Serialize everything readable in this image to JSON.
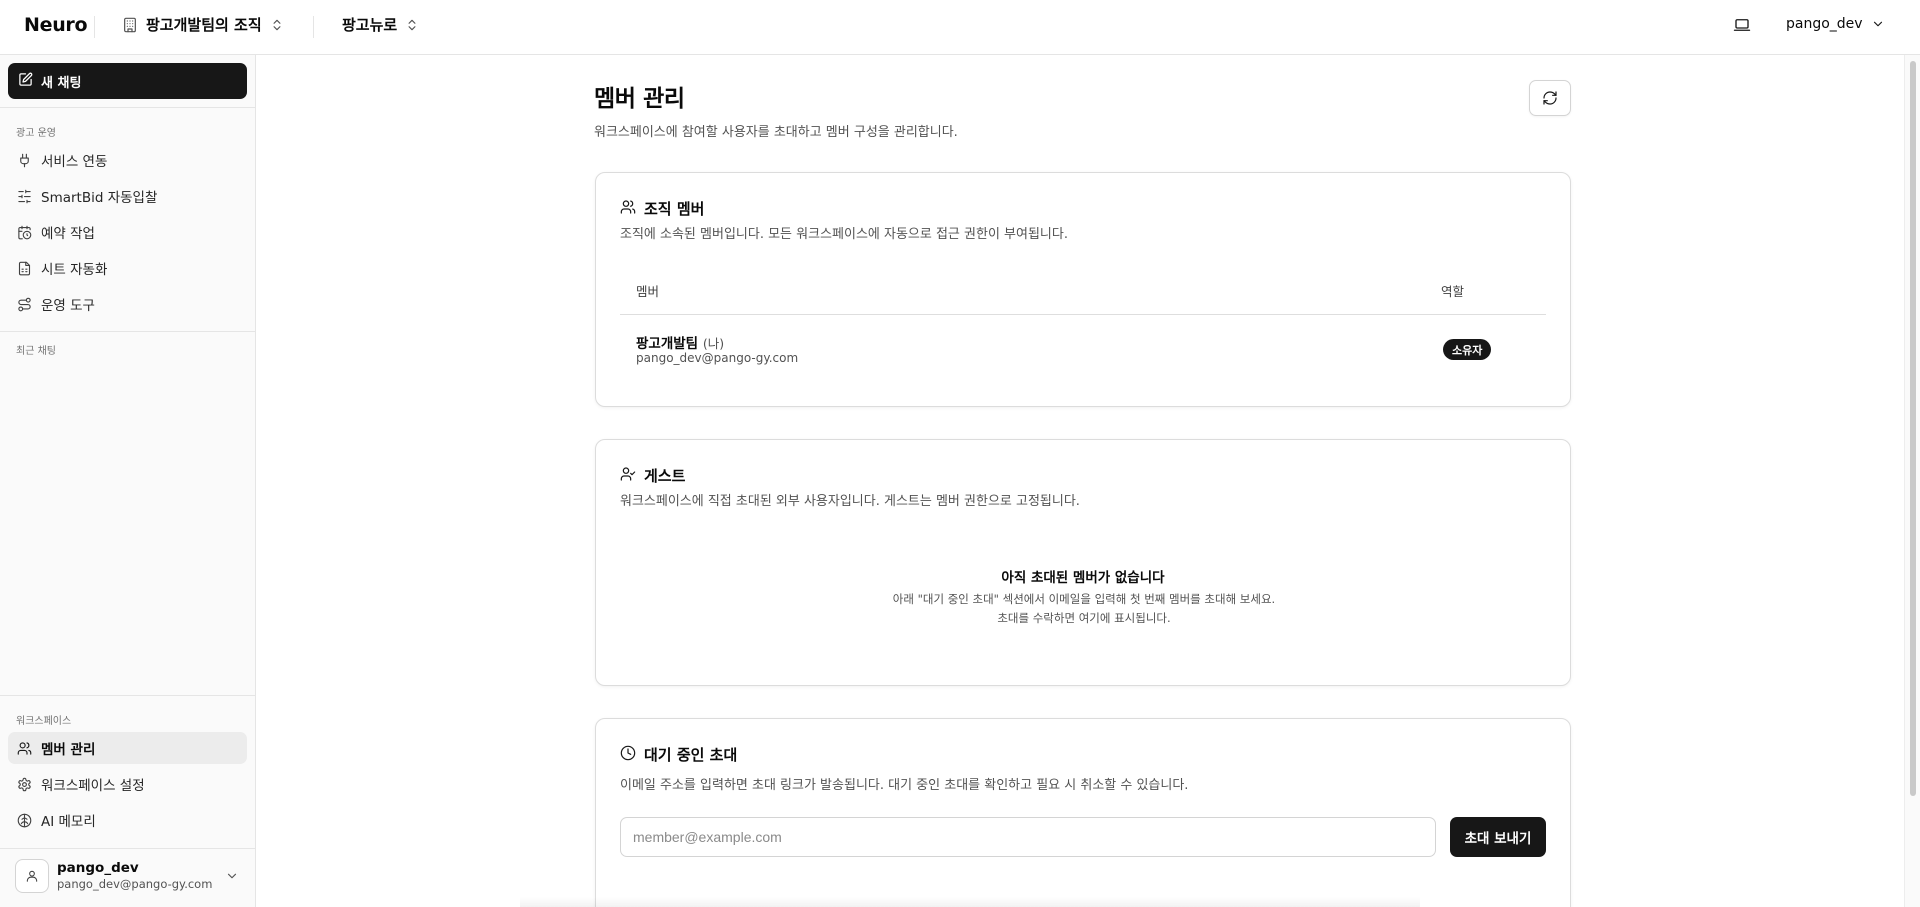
{
  "header": {
    "logo": "Neuro",
    "org_name": "팡고개발팀의 조직",
    "project_name": "팡고뉴로",
    "username": "pango_dev"
  },
  "sidebar": {
    "new_chat_label": "새 채팅",
    "ads_group_label": "광고 운영",
    "ads_items": [
      {
        "label": "서비스 연동",
        "icon": "plug-icon"
      },
      {
        "label": "SmartBid 자동입찰",
        "icon": "sliders-icon"
      },
      {
        "label": "예약 작업",
        "icon": "calendar-clock-icon"
      },
      {
        "label": "시트 자동화",
        "icon": "file-sheet-icon"
      },
      {
        "label": "운영 도구",
        "icon": "route-icon"
      }
    ],
    "recent_chats_label": "최근 채팅",
    "workspace_group_label": "워크스페이스",
    "workspace_items": [
      {
        "label": "멤버 관리",
        "icon": "users-icon",
        "active": true
      },
      {
        "label": "워크스페이스 설정",
        "icon": "gear-icon"
      },
      {
        "label": "AI 메모리",
        "icon": "brain-icon"
      }
    ],
    "user": {
      "name": "pango_dev",
      "email": "pango_dev@pango-gy.com"
    }
  },
  "main": {
    "title": "멤버 관리",
    "subtitle": "워크스페이스에 참여할 사용자를 초대하고 멤버 구성을 관리합니다.",
    "org_members": {
      "title": "조직 멤버",
      "description": "조직에 소속된 멤버입니다. 모든 워크스페이스에 자동으로 접근 권한이 부여됩니다.",
      "columns": [
        "멤버",
        "역할"
      ],
      "rows": [
        {
          "name": "팡고개발팀",
          "me_tag": "(나)",
          "email": "pango_dev@pango-gy.com",
          "role": "소유자"
        }
      ]
    },
    "guests": {
      "title": "게스트",
      "description": "워크스페이스에 직접 초대된 외부 사용자입니다. 게스트는 멤버 권한으로 고정됩니다.",
      "empty_title": "아직 초대된 멤버가 없습니다",
      "empty_desc": "아래 \"대기 중인 초대\" 섹션에서 이메일을 입력해 첫 번째 멤버를 초대해 보세요. 초대를 수락하면 여기에 표시됩니다."
    },
    "pending": {
      "title": "대기 중인 초대",
      "description": "이메일 주소를 입력하면 초대 링크가 발송됩니다. 대기 중인 초대를 확인하고 필요 시 취소할 수 있습니다.",
      "email_placeholder": "member@example.com",
      "email_value": "",
      "invite_button": "초대 보내기"
    }
  },
  "colors": {
    "primary": "#171717",
    "border": "#e5e5e5",
    "sidebar_bg": "#fafafa",
    "muted_text": "#525252"
  }
}
